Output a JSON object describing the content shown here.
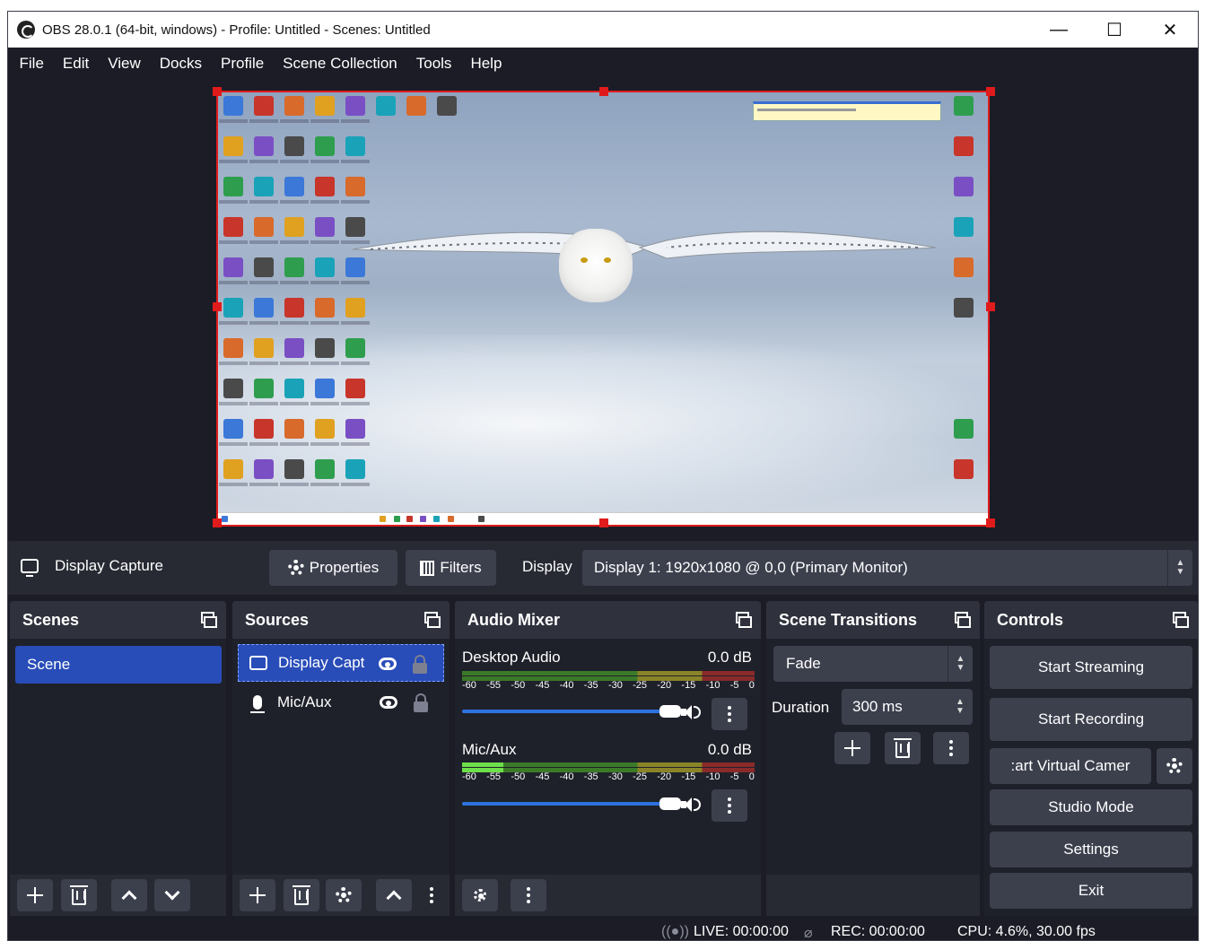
{
  "window": {
    "title": "OBS 28.0.1 (64-bit, windows) - Profile: Untitled - Scenes: Untitled",
    "minimize": "—",
    "maximize": "☐",
    "close": "✕"
  },
  "menu": [
    "File",
    "Edit",
    "View",
    "Docks",
    "Profile",
    "Scene Collection",
    "Tools",
    "Help"
  ],
  "source_toolbar": {
    "source_name": "Display Capture",
    "properties_label": "Properties",
    "filters_label": "Filters",
    "display_label": "Display",
    "display_value": "Display 1: 1920x1080 @ 0,0 (Primary Monitor)"
  },
  "scenes": {
    "title": "Scenes",
    "items": [
      "Scene"
    ]
  },
  "sources": {
    "title": "Sources",
    "items": [
      {
        "name": "Display Capt",
        "icon": "monitor-icon"
      },
      {
        "name": "Mic/Aux",
        "icon": "microphone-icon"
      }
    ]
  },
  "audio_mixer": {
    "title": "Audio Mixer",
    "channels": [
      {
        "name": "Desktop Audio",
        "db": "0.0 dB",
        "level": 0.0
      },
      {
        "name": "Mic/Aux",
        "db": "0.0 dB",
        "level": 0.14
      }
    ],
    "ticks": [
      "-60",
      "-55",
      "-50",
      "-45",
      "-40",
      "-35",
      "-30",
      "-25",
      "-20",
      "-15",
      "-10",
      "-5",
      "0"
    ]
  },
  "scene_transitions": {
    "title": "Scene Transitions",
    "transition": "Fade",
    "duration_label": "Duration",
    "duration_value": "300 ms"
  },
  "controls": {
    "title": "Controls",
    "start_streaming": "Start Streaming",
    "start_recording": "Start Recording",
    "start_virtual_camera": ":art Virtual Camer",
    "studio_mode": "Studio Mode",
    "settings": "Settings",
    "exit": "Exit"
  },
  "status": {
    "live": "LIVE: 00:00:00",
    "rec": "REC: 00:00:00",
    "cpu": "CPU: 4.6%, 30.00 fps"
  },
  "colors": {
    "accent": "#284cb8",
    "selection": "#e01b1b",
    "background": "#1b1c26",
    "panel": "#272a33"
  }
}
